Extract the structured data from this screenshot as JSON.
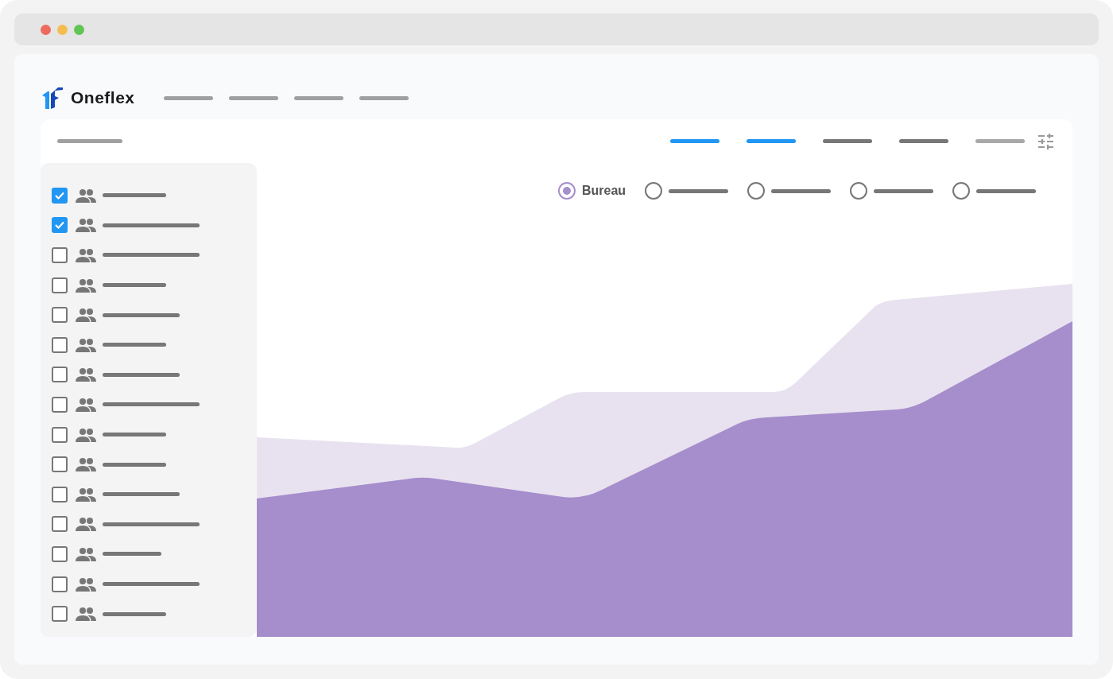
{
  "brand": {
    "name": "Oneflex"
  },
  "nav_items": [
    {
      "selected": false
    },
    {
      "selected": false
    },
    {
      "selected": false
    },
    {
      "selected": false
    }
  ],
  "toolbar_tabs": [
    {
      "selected": true,
      "disabled": false
    },
    {
      "selected": true,
      "disabled": false
    },
    {
      "selected": false,
      "disabled": false
    },
    {
      "selected": false,
      "disabled": false
    },
    {
      "selected": false,
      "disabled": true
    }
  ],
  "groups": [
    {
      "checked": true
    },
    {
      "checked": true
    },
    {
      "checked": false
    },
    {
      "checked": false
    },
    {
      "checked": false
    },
    {
      "checked": false
    },
    {
      "checked": false
    },
    {
      "checked": false
    },
    {
      "checked": false
    },
    {
      "checked": false
    },
    {
      "checked": false
    },
    {
      "checked": false
    },
    {
      "checked": false
    },
    {
      "checked": false
    },
    {
      "checked": false
    }
  ],
  "series_options": [
    {
      "label": "Bureau",
      "selected": true
    },
    {
      "selected": false
    },
    {
      "selected": false
    },
    {
      "selected": false
    },
    {
      "selected": false
    }
  ]
}
